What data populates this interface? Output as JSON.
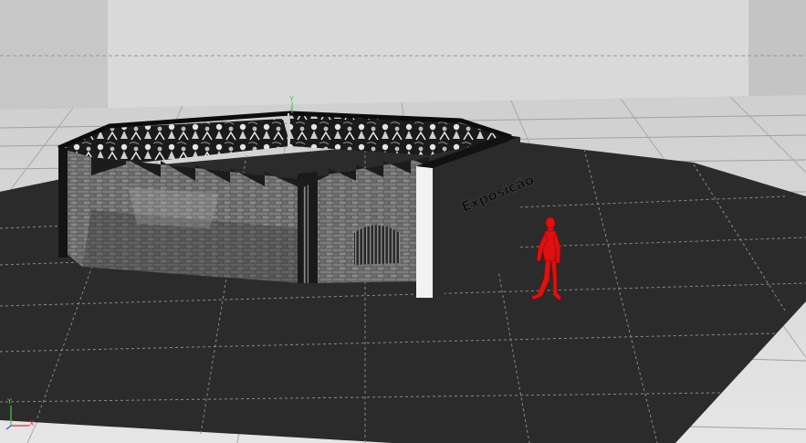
{
  "viewport": {
    "mode": "perspective-3d-viewport",
    "sign_text": "Exposição",
    "axis_labels": {
      "y": "Y",
      "x": "X"
    },
    "colors": {
      "background_wall": "#d9d9d9",
      "background_side": "#c5c5c5",
      "floor_far": "#cfcfcf",
      "floor_near": "#e6e6e6",
      "ground_plane": "#2b2b2b",
      "grid_line": "#8a8a8a",
      "figure": "#dd1111",
      "axis_x": "#dd3333",
      "axis_y": "#44cc44",
      "axis_z": "#3355dd"
    }
  }
}
